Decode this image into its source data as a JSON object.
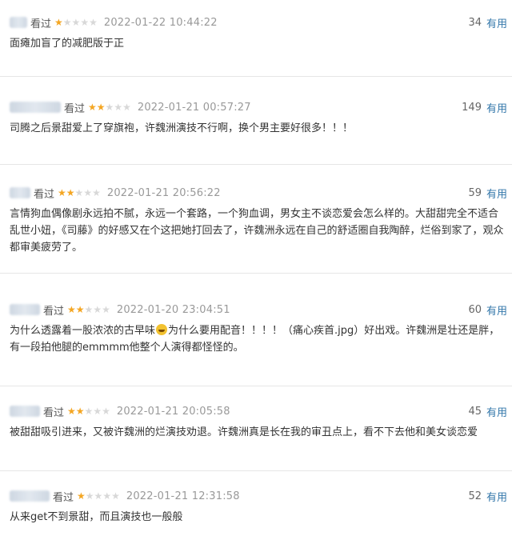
{
  "seen_label": "看过",
  "useful_label": "有用",
  "reviews": [
    {
      "stars": 1,
      "time": "2022-01-22 10:44:22",
      "count": "34",
      "text": "面瘫加盲了的减肥版于正"
    },
    {
      "stars": 2,
      "time": "2022-01-21 00:57:27",
      "count": "149",
      "text": "司腾之后景甜爱上了穿旗袍，许魏洲演技不行啊，换个男主要好很多！！！"
    },
    {
      "stars": 2,
      "time": "2022-01-21 20:56:22",
      "count": "59",
      "text": "言情狗血偶像剧永远拍不腻，永远一个套路，一个狗血调，男女主不谈恋爱会怎么样的。大甜甜完全不适合乱世小妞，《司藤》的好感又在个这把她打回去了，许魏洲永远在自己的舒适圈自我陶醉，烂俗到家了，观众都审美疲劳了。"
    },
    {
      "stars": 2,
      "time": "2022-01-20 23:04:51",
      "count": "60",
      "text_a": "为什么透露着一股浓浓的古早味",
      "text_b": "为什么要用配音！！！！（痛心疾首.jpg）好出戏。许魏洲是壮还是胖，有一段拍他腿的emmmm他整个人演得都怪怪的。"
    },
    {
      "stars": 2,
      "time": "2022-01-21 20:05:58",
      "count": "45",
      "text": "被甜甜吸引进来，又被许魏洲的烂演技劝退。许魏洲真是长在我的审丑点上，看不下去他和美女谈恋爱"
    },
    {
      "stars": 1,
      "time": "2022-01-21 12:31:58",
      "count": "52",
      "text": "从来get不到景甜，而且演技也一般般"
    }
  ],
  "colors": {
    "star_on": "#f4a623",
    "star_off": "#d8d8d8",
    "useful": "#3377aa"
  },
  "icons": {
    "star": "star-icon",
    "emoji": "grinning-sweat-emoji-icon"
  }
}
